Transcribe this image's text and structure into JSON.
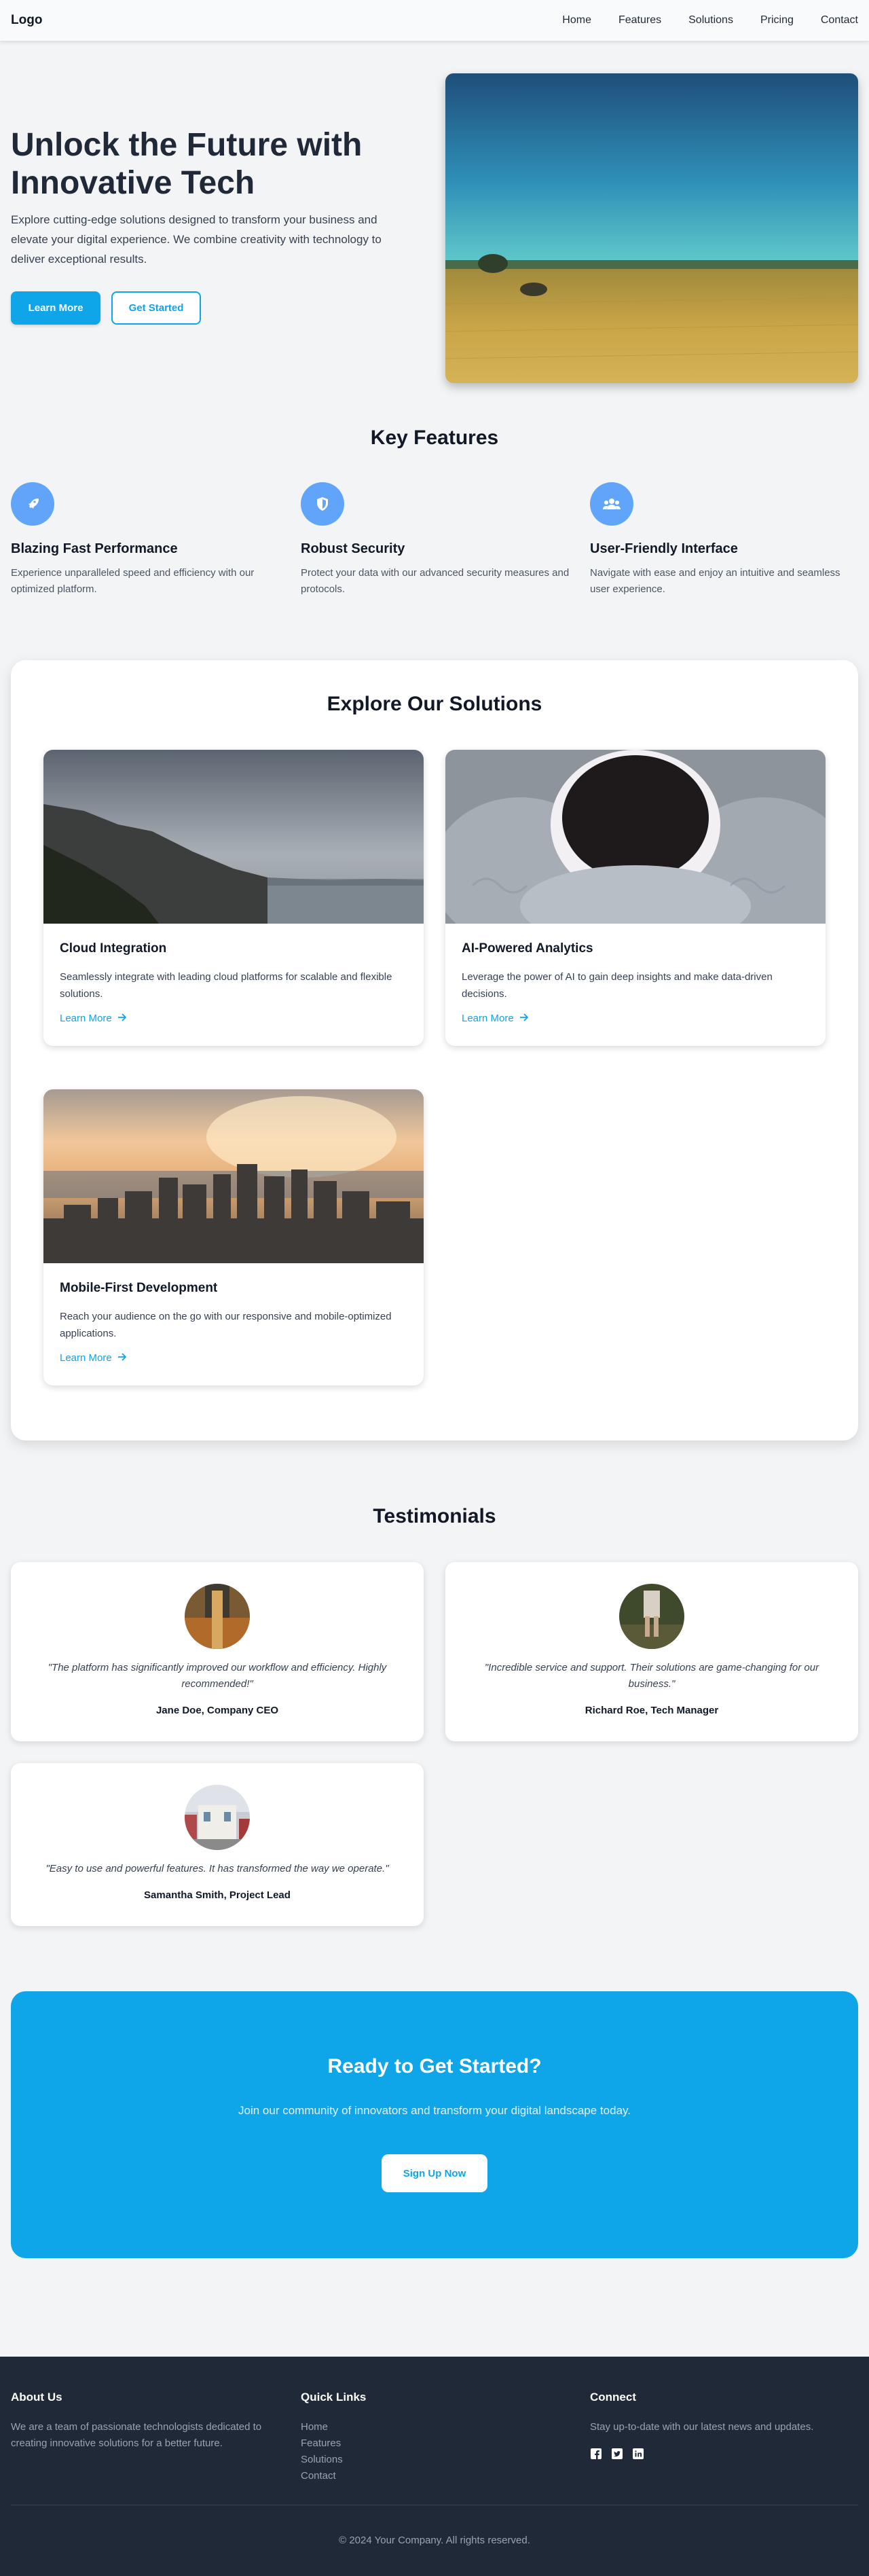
{
  "header": {
    "logo": "Logo",
    "nav": [
      "Home",
      "Features",
      "Solutions",
      "Pricing",
      "Contact"
    ]
  },
  "hero": {
    "title": "Unlock the Future with Innovative Tech",
    "description": "Explore cutting-edge solutions designed to transform your business and elevate your digital experience. We combine creativity with technology to deliver exceptional results.",
    "primary_button": "Learn More",
    "secondary_button": "Get Started"
  },
  "features": {
    "title": "Key Features",
    "items": [
      {
        "icon": "rocket-icon",
        "title": "Blazing Fast Performance",
        "text": "Experience unparalleled speed and efficiency with our optimized platform."
      },
      {
        "icon": "shield-icon",
        "title": "Robust Security",
        "text": "Protect your data with our advanced security measures and protocols."
      },
      {
        "icon": "users-icon",
        "title": "User-Friendly Interface",
        "text": "Navigate with ease and enjoy an intuitive and seamless user experience."
      }
    ]
  },
  "solutions": {
    "title": "Explore Our Solutions",
    "link_label": "Learn More",
    "items": [
      {
        "title": "Cloud Integration",
        "text": "Seamlessly integrate with leading cloud platforms for scalable and flexible solutions."
      },
      {
        "title": "AI-Powered Analytics",
        "text": "Leverage the power of AI to gain deep insights and make data-driven decisions."
      },
      {
        "title": "Mobile-First Development",
        "text": "Reach your audience on the go with our responsive and mobile-optimized applications."
      }
    ]
  },
  "testimonials": {
    "title": "Testimonials",
    "items": [
      {
        "quote": "\"The platform has significantly improved our workflow and efficiency. Highly recommended!\"",
        "name": "Jane Doe, Company CEO"
      },
      {
        "quote": "\"Incredible service and support. Their solutions are game-changing for our business.\"",
        "name": "Richard Roe, Tech Manager"
      },
      {
        "quote": "\"Easy to use and powerful features. It has transformed the way we operate.\"",
        "name": "Samantha Smith, Project Lead"
      }
    ]
  },
  "cta": {
    "title": "Ready to Get Started?",
    "text": "Join our community of innovators and transform your digital landscape today.",
    "button": "Sign Up Now"
  },
  "footer": {
    "about_title": "About Us",
    "about_text": "We are a team of passionate technologists dedicated to creating innovative solutions for a better future.",
    "links_title": "Quick Links",
    "links": [
      "Home",
      "Features",
      "Solutions",
      "Contact"
    ],
    "connect_title": "Connect",
    "connect_text": "Stay up-to-date with our latest news and updates.",
    "social_icons": [
      "facebook-icon",
      "twitter-icon",
      "linkedin-icon"
    ],
    "copyright": "© 2024 Your Company. All rights reserved."
  },
  "colors": {
    "accent": "#0ea5e9",
    "feature_icon_bg": "#60a5fa",
    "footer_bg": "#1f2937",
    "page_bg": "#f3f4f6"
  }
}
